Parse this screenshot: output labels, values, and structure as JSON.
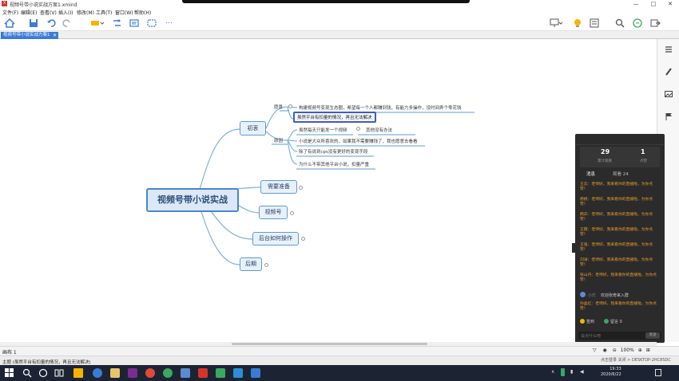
{
  "window": {
    "title": "视频号带小说实战方案1.xmind",
    "app_logo": "X",
    "controls": {
      "minimize": "—",
      "maximize": "□",
      "close": "✕"
    }
  },
  "menu": [
    "文件(F)",
    "编辑(E)",
    "查看(V)",
    "插入(I)",
    "修改(M)",
    "工具(T)",
    "窗口(W)",
    "帮助(H)"
  ],
  "toolbar": {
    "more": "…"
  },
  "tab": {
    "label": "视频号带小说实战方案1",
    "close": "✕"
  },
  "mindmap": {
    "root": "视频号带小说实战",
    "branches": {
      "early": "初衷",
      "prepare": "需要准备",
      "channel": "视频号",
      "backend": "后台如何操作",
      "later": "后期"
    },
    "sub": {
      "origin": "愿景",
      "reason": "原因"
    },
    "leaves": {
      "origin_1": "构建视频号变现生态圈，希望每一个人都赚到钱，有能力多操作，没时间弄个零花钱",
      "origin_2": "虽然平台有扣量的情况，再且无法解决",
      "reason_1": "虽然每天只能发一个视频",
      "reason_1b": "其他没有办法",
      "reason_2": "小说是大众所喜欢的，如果我不需要赚钱了，我也愿意去看看",
      "reason_3": "除了有说到cps没有更好的变现手段",
      "reason_4": "为什么不带其他平台小说，扣量严重"
    }
  },
  "sheet": {
    "label": "画布 1",
    "zoom": "100%"
  },
  "status": {
    "text": "主题 (虽然平台有扣量的情况，再且无法解决)"
  },
  "chat": {
    "stats": [
      {
        "num": "29",
        "label": "累计观看"
      },
      {
        "num": "1",
        "label": "点赞"
      }
    ],
    "tabs": [
      "消息",
      "观看 24"
    ],
    "messages": [
      "王云：老师好，我来看你的直播啦，为你点赞！",
      "杨帆：老师好，我来看你的直播啦，为你点赞！",
      "韩庆：老师好，我来看你的直播啦，为你点赞！",
      "王薇：老师好，我来看你的直播啦，为你点赞！",
      "王强：老师好，我来看你的直播啦，为你点赞！",
      "刘涛：老师好，我来看你的直播啦，为你点赞！",
      "张山丹：老师好，我来看你的直播啦，为你点赞！"
    ],
    "join": "欢迎张奇来入群",
    "join_prefix": "小灯",
    "after_join": "孙晶红：老师好，我来看你的直播啦，为你点赞！",
    "gifts": [
      "签到",
      "留言 0"
    ],
    "input_placeholder": "说点什么吧",
    "send": "发送"
  },
  "tray": {
    "line1": "点击登录  关闭  >  DESKTOP-2HC8SDC",
    "time": "19:33",
    "date": "2020/6/22"
  },
  "colors": {
    "accent": "#3a7bd5",
    "node_border": "#5b9bd5",
    "chat_orange": "#e89a2e",
    "taskbar": "#1c2433"
  }
}
